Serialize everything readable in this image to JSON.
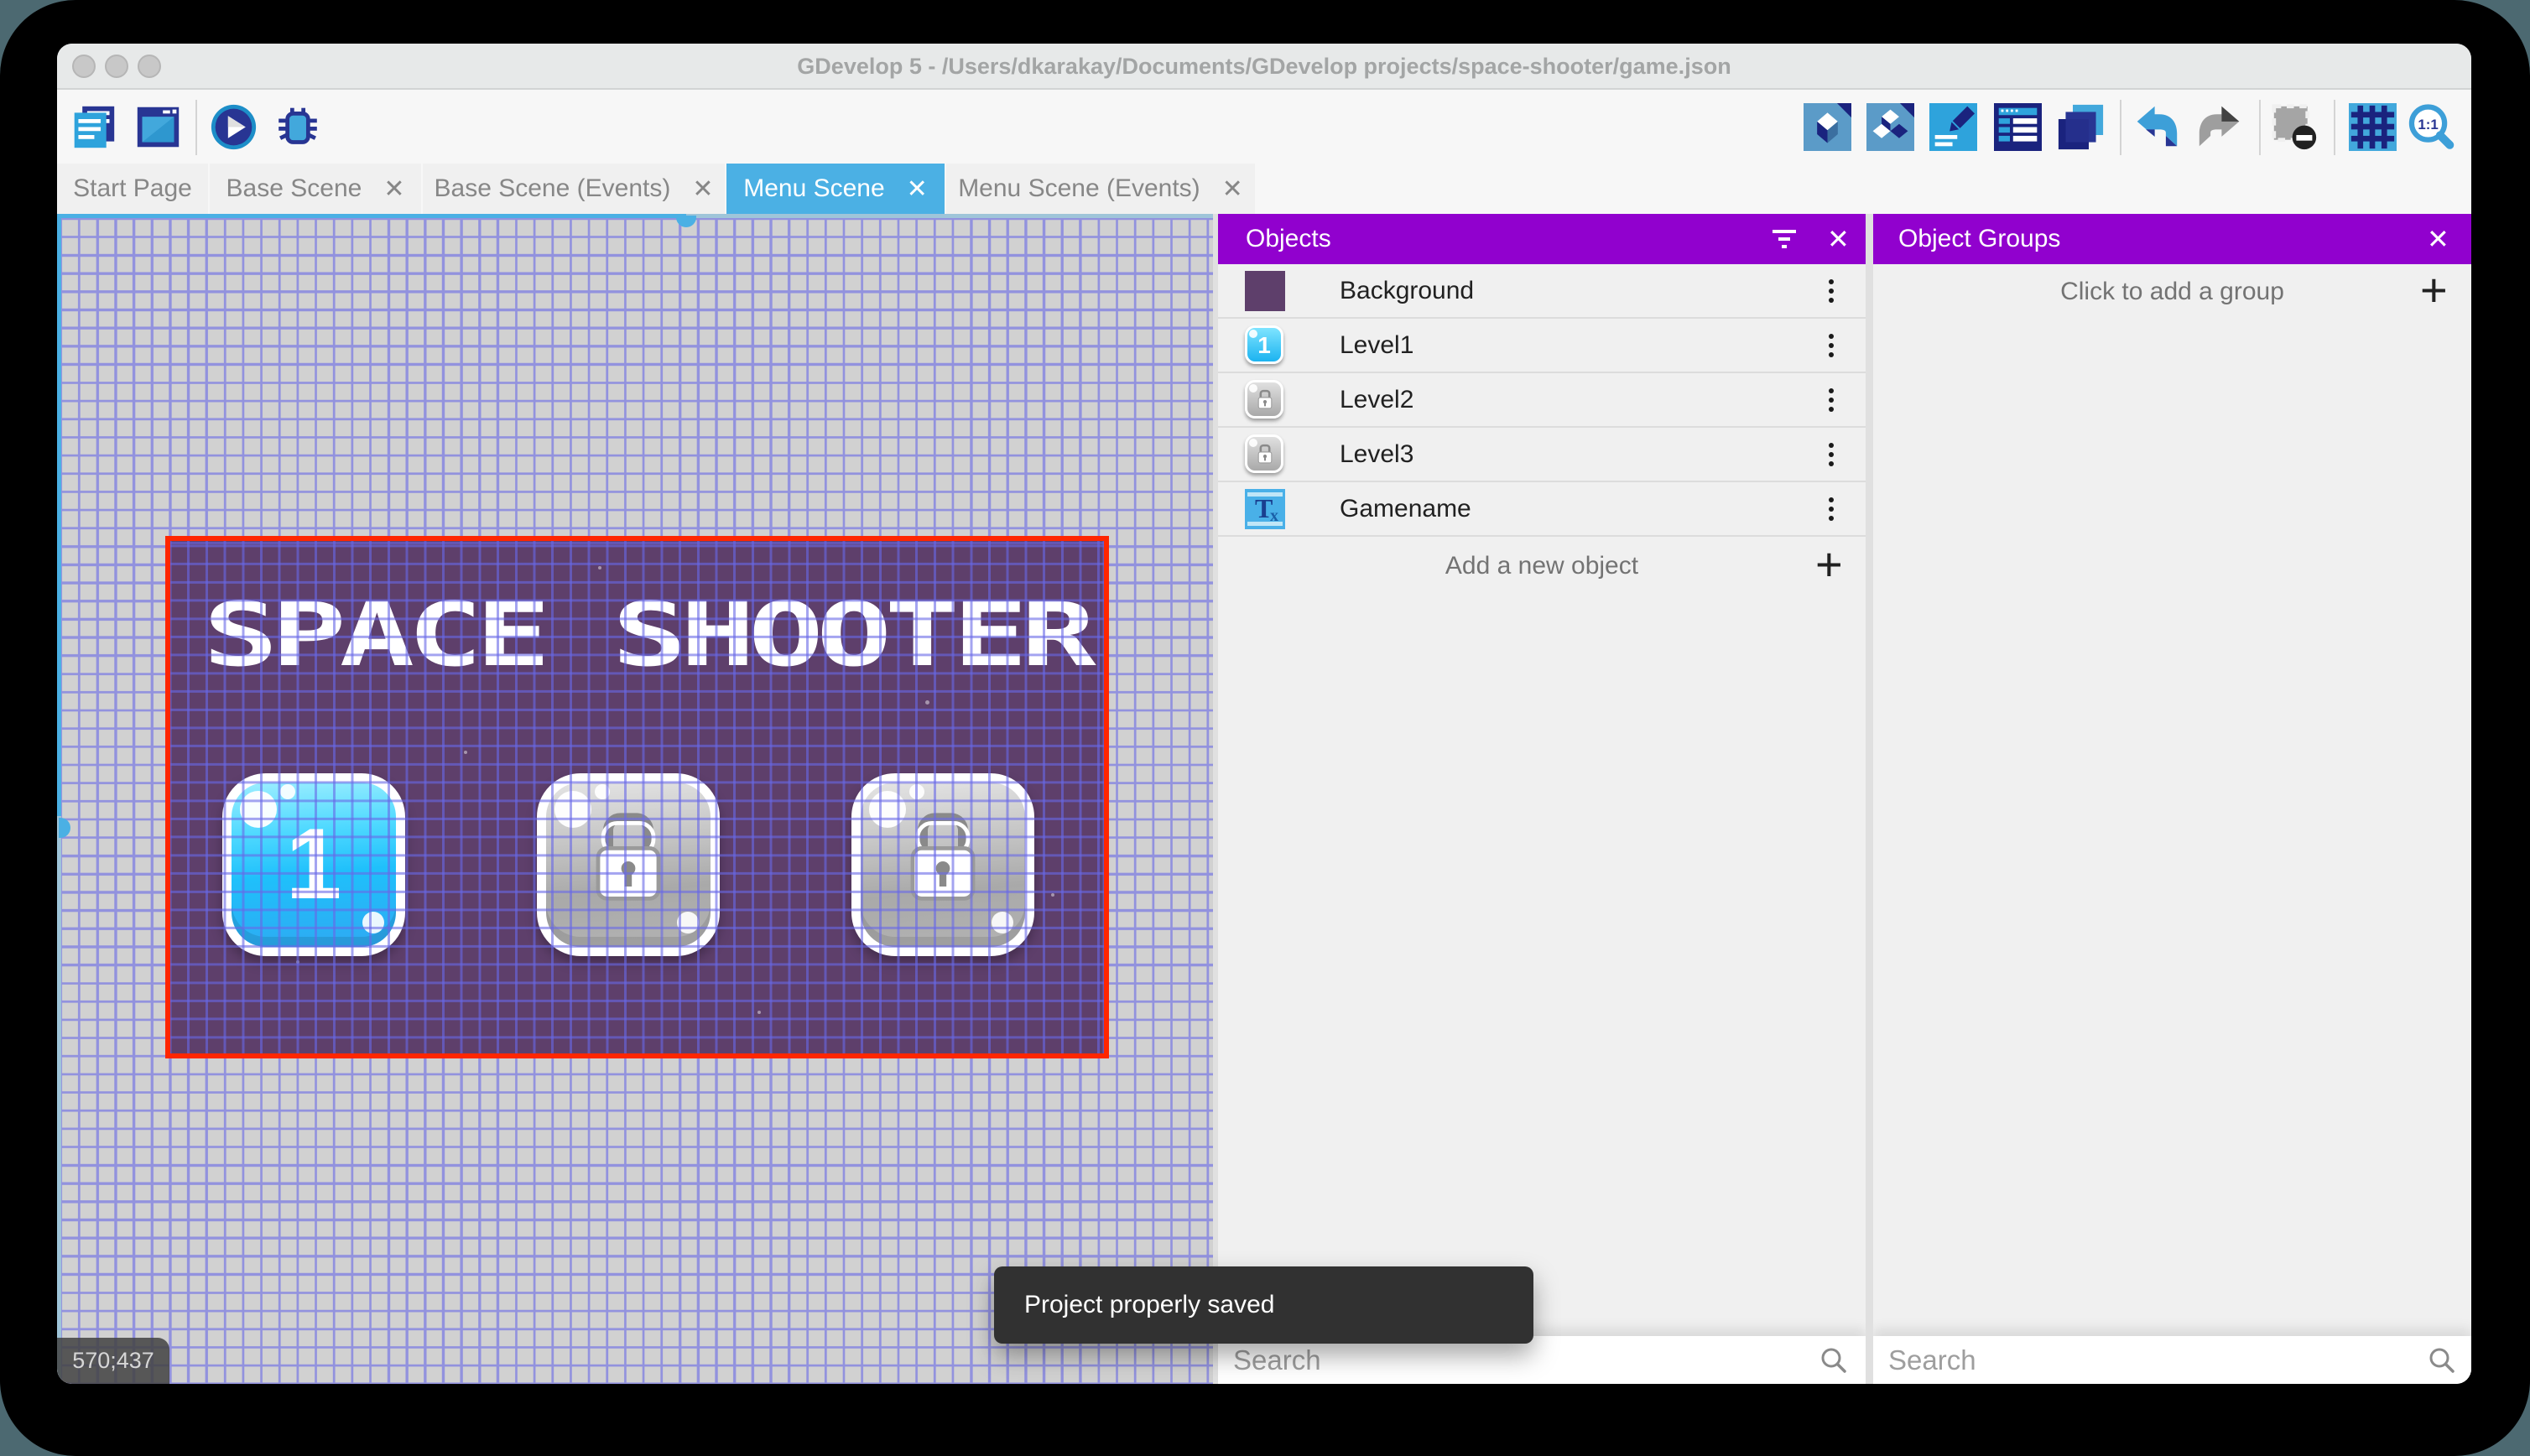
{
  "window": {
    "title": "GDevelop 5 - /Users/dkarakay/Documents/GDevelop projects/space-shooter/game.json"
  },
  "tabs": [
    {
      "label": "Start Page",
      "closable": false,
      "active": false
    },
    {
      "label": "Base Scene",
      "closable": true,
      "active": false
    },
    {
      "label": "Base Scene (Events)",
      "closable": true,
      "active": false
    },
    {
      "label": "Menu Scene",
      "closable": true,
      "active": true
    },
    {
      "label": "Menu Scene (Events)",
      "closable": true,
      "active": false
    }
  ],
  "close_glyph": "✕",
  "canvas": {
    "scene_title": "SPACE SHOOTER",
    "level1_button_label": "1",
    "coordinates_badge": "570;437"
  },
  "objects_panel": {
    "title": "Objects",
    "items": [
      {
        "name": "Background",
        "icon": "background-swatch"
      },
      {
        "name": "Level1",
        "icon": "level1-button"
      },
      {
        "name": "Level2",
        "icon": "locked-level-button"
      },
      {
        "name": "Level3",
        "icon": "locked-level-button"
      },
      {
        "name": "Gamename",
        "icon": "text-object"
      }
    ],
    "add_label": "Add a new object",
    "search_placeholder": "Search"
  },
  "groups_panel": {
    "title": "Object Groups",
    "add_label": "Click to add a group",
    "search_placeholder": "Search"
  },
  "toast": {
    "message": "Project properly saved"
  },
  "colors": {
    "panel_header": "#9101ce",
    "active_tab": "#4bb0e4",
    "scene_background": "#5e3f6b",
    "selection_border": "#ff2600",
    "grid_line": "#9292de",
    "canvas_background": "#d1d1d1"
  }
}
